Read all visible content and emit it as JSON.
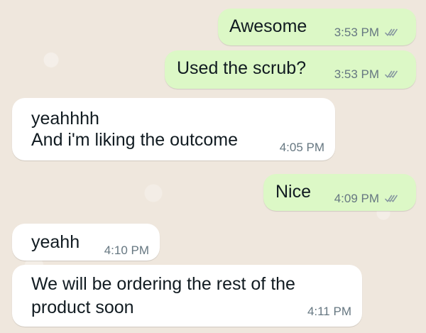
{
  "messages": [
    {
      "direction": "outgoing",
      "text": "Awesome",
      "time": "3:53 PM",
      "status": "read"
    },
    {
      "direction": "outgoing",
      "text": "Used the scrub?",
      "time": "3:53 PM",
      "status": "read"
    },
    {
      "direction": "incoming",
      "lines": [
        "yeahhhh",
        "And i'm liking the outcome"
      ],
      "time": "4:05 PM"
    },
    {
      "direction": "outgoing",
      "text": "Nice",
      "time": "4:09 PM",
      "status": "read"
    },
    {
      "direction": "incoming",
      "text": "yeahh",
      "time": "4:10 PM"
    },
    {
      "direction": "incoming",
      "lines": [
        "We will be ordering the rest of the",
        "product soon"
      ],
      "time": "4:11 PM"
    }
  ],
  "colors": {
    "outgoing_bubble": "#dcf8c6",
    "incoming_bubble": "#ffffff",
    "background": "#efe7dd",
    "meta_text": "#667781"
  },
  "icons": {
    "read_receipt": "double-check-icon"
  }
}
